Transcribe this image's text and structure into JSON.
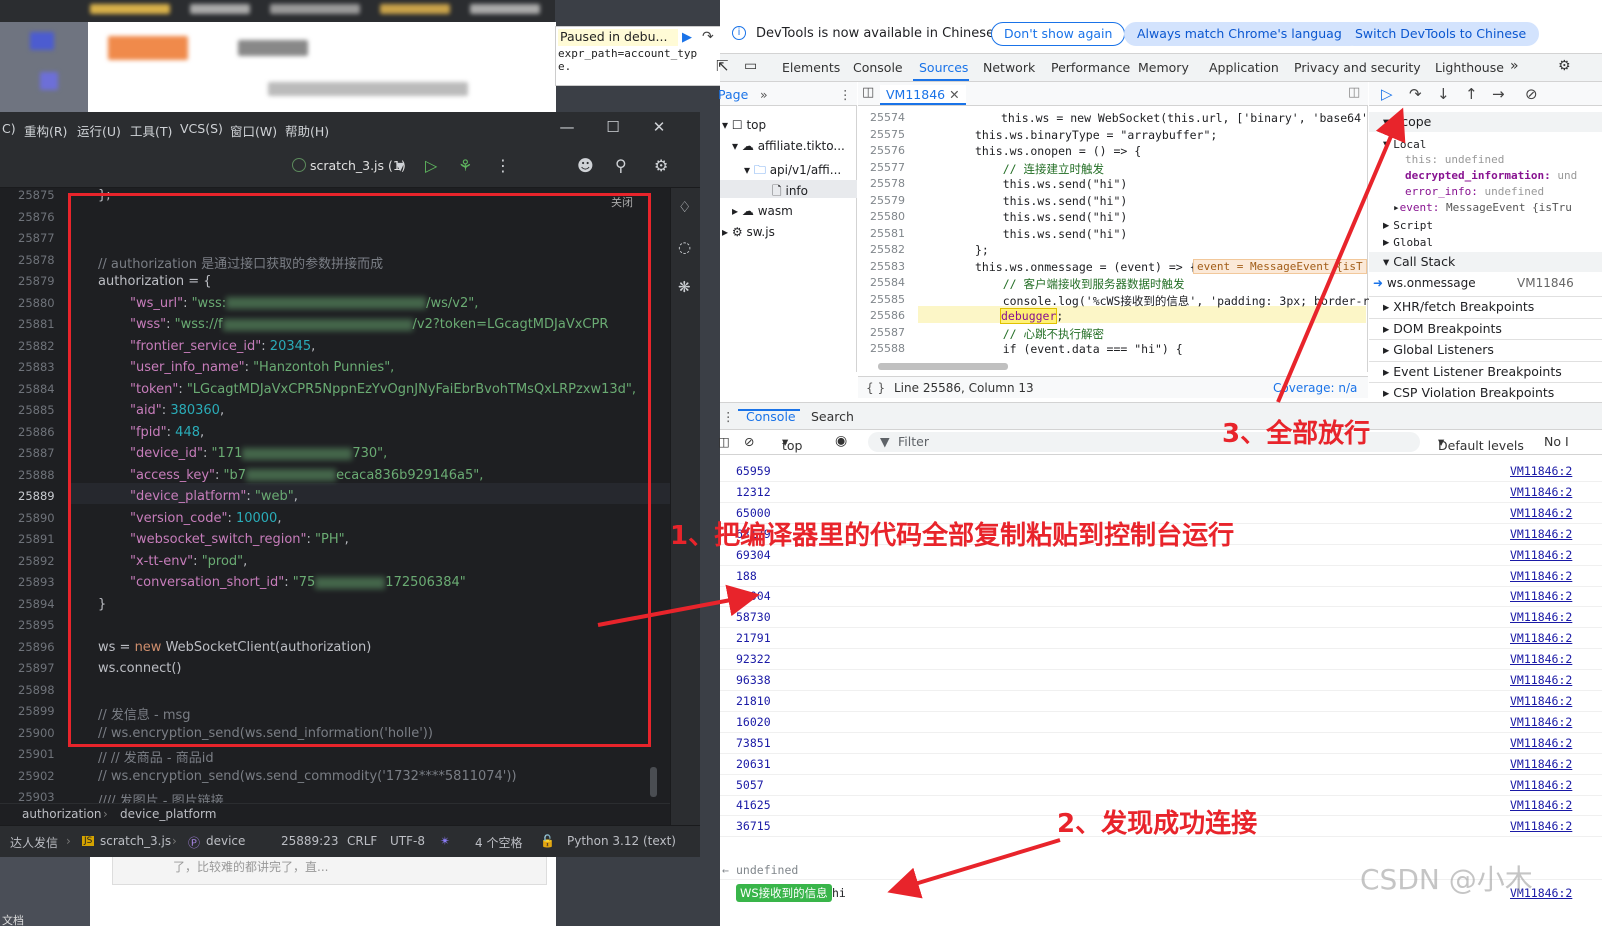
{
  "paused_bubble": {
    "title": "Paused in debu...",
    "code": "expr_path=account_typ\ne."
  },
  "ide": {
    "menu": [
      {
        "label": "C)",
        "name": "menu-code"
      },
      {
        "label": "重构(R)",
        "name": "menu-refactor"
      },
      {
        "label": "运行(U)",
        "name": "menu-run"
      },
      {
        "label": "工具(T)",
        "name": "menu-tools"
      },
      {
        "label": "VCS(S)",
        "name": "menu-vcs"
      },
      {
        "label": "窗口(W)",
        "name": "menu-window"
      },
      {
        "label": "帮助(H)",
        "name": "menu-help"
      }
    ],
    "run_config": "scratch_3.js (1)",
    "close_hint": "关闭",
    "line_numbers": [
      "25875",
      "25876",
      "25877",
      "25878",
      "25879",
      "25880",
      "25881",
      "25882",
      "25883",
      "25884",
      "25885",
      "25886",
      "25887",
      "25888",
      "25889",
      "25890",
      "25891",
      "25892",
      "25893",
      "25894",
      "25895",
      "25896",
      "25897",
      "25898",
      "25899",
      "25900",
      "25901",
      "25902",
      "25903"
    ],
    "active_line": "25889",
    "code": {
      "l0": "};",
      "comment_auth": "// authorization 是通过接口获取的参数拼接而成",
      "auth_open": "authorization = {",
      "ws_url_key": "\"ws_url\"",
      "ws_url_val": "\"wss:",
      "ws_url_tail": "/ws/v2\",",
      "wss_key": "\"wss\"",
      "wss_val": "\"wss://f",
      "wss_tail": "/v2?token=LGcagtMDJaVxCPR",
      "frontier_key": "\"frontier_service_id\"",
      "frontier_val": "20345",
      "user_info_key": "\"user_info_name\"",
      "user_info_val": "\"Hanzontoh Punnies\",",
      "token_key": "\"token\"",
      "token_val": "\"LGcagtMDJaVxCPR5NppnEzYvOgnJNyFaiEbrBvohTMsQxLRPzxw13d\",",
      "aid_key": "\"aid\"",
      "aid_val": "380360",
      "fpid_key": "\"fpid\"",
      "fpid_val": "448",
      "device_id_key": "\"device_id\"",
      "device_id_val": "\"171",
      "device_id_tail": "730\",",
      "access_key_key": "\"access_key\"",
      "access_key_val": "\"b7",
      "access_key_tail": "ecaca836b929146a5\",",
      "platform_key": "\"device_platform\"",
      "platform_val": "\"web\"",
      "version_key": "\"version_code\"",
      "version_val": "10000",
      "region_key": "\"websocket_switch_region\"",
      "region_val": "\"PH\"",
      "env_key": "\"x-tt-env\"",
      "env_val": "\"prod\"",
      "conv_key": "\"conversation_short_id\"",
      "conv_val": "\"75",
      "conv_tail": "172506384\"",
      "close_brace": "}",
      "ws_new_a": "ws = ",
      "ws_new_kw": "new",
      "ws_new_b": " WebSocketClient(authorization)",
      "ws_connect": "ws.connect()",
      "comment_msg": "// 发信息 - msg",
      "comment_send_info": "// ws.encryption_send(ws.send_information('holle'))",
      "comment_goods": "// // 发商品 - 商品id",
      "comment_send_goods": "// ws.encryption_send(ws.send_commodity('1732****5811074'))",
      "comment_img": "//// 发图片 - 图片链接"
    },
    "breadcrumbs": [
      "authorization",
      "device_platform"
    ],
    "status": {
      "project": "达人发信",
      "file": "scratch_3.js",
      "symbol": "device",
      "position": "25889:23",
      "line_sep": "CRLF",
      "encoding": "UTF-8",
      "indent": "4 个空格",
      "language": "Python 3.12 (text)"
    }
  },
  "bg": {
    "bottom_left_text": "文档",
    "bottom_page_text": "了，比较难的都讲完了，直..."
  },
  "devtools": {
    "infobar": {
      "text": "DevTools is now available in Chinese",
      "dont_show": "Don't show again",
      "match": "Always match Chrome's language",
      "switch": "Switch DevTools to Chinese"
    },
    "tabs": [
      "Elements",
      "Console",
      "Sources",
      "Network",
      "Performance",
      "Memory",
      "Application",
      "Privacy and security",
      "Lighthouse"
    ],
    "active_tab": "Sources",
    "nav": {
      "page_tab": "Page",
      "tree": [
        "top",
        "affiliate.tikto...",
        "api/v1/affi...",
        "info",
        "wasm",
        "sw.js"
      ]
    },
    "editor": {
      "file_tab": "VM11846",
      "line_numbers": [
        "25574",
        "25575",
        "25576",
        "25577",
        "25578",
        "25579",
        "25580",
        "25581",
        "25582",
        "25583",
        "25584",
        "25585",
        "25586",
        "25587",
        "25588"
      ],
      "lines": {
        "a1": "this.ws = new WebSocket(this.url, ['binary', 'base64',",
        "a2": "this.ws.binaryType = \"arraybuffer\";",
        "a3": "this.ws.onopen = () => {",
        "a4": "    // 连接建立时触发",
        "a5": "    this.ws.send(\"hi\")",
        "a6": "    this.ws.send(\"hi\")",
        "a7": "    this.ws.send(\"hi\")",
        "a8": "    this.ws.send(\"hi\")",
        "a9": "};",
        "a10": "this.ws.onmessage = (event) => {",
        "a11": "    // 客户端接收到服务器数据时触发",
        "a12": "    console.log('%cWS接收到的信息', 'padding: 3px; border-rad",
        "a13_kw": "debugger",
        "a14": "    // 心跳不执行解密",
        "a15": "    if (event.data === \"hi\") {"
      },
      "inline_value": "event = MessageEvent {isT",
      "footer_position": "Line 25586, Column 13",
      "footer_coverage": "Coverage: n/a"
    },
    "debugger": {
      "scope": "Scope",
      "local": "Local",
      "vars": [
        {
          "name": "this:",
          "value": "undefined"
        },
        {
          "name": "decrypted_information:",
          "value": "und"
        },
        {
          "name": "error_info:",
          "value": "undefined"
        },
        {
          "name": "event:",
          "value": "MessageEvent {isTru"
        }
      ],
      "script": "Script",
      "global": "Global",
      "call_stack": "Call Stack",
      "frame_name": "ws.onmessage",
      "frame_src": "VM11846",
      "sections": [
        "XHR/fetch Breakpoints",
        "DOM Breakpoints",
        "Global Listeners",
        "Event Listener Breakpoints",
        "CSP Violation Breakpoints"
      ]
    },
    "drawer_tabs": [
      "Console",
      "Search"
    ],
    "console_toolbar": {
      "context": "top",
      "filter": "Filter",
      "levels": "Default levels",
      "issues": "No I"
    },
    "console_rows": [
      {
        "v": "65959",
        "src": "VM11846:2"
      },
      {
        "v": "12312",
        "src": "VM11846:2"
      },
      {
        "v": "65000",
        "src": "VM11846:2"
      },
      {
        "v": "63179",
        "src": "VM11846:2"
      },
      {
        "v": "69304",
        "src": "VM11846:2"
      },
      {
        "v": "188",
        "src": "VM11846:2"
      },
      {
        "v": "22004",
        "src": "VM11846:2"
      },
      {
        "v": "58730",
        "src": "VM11846:2"
      },
      {
        "v": "21791",
        "src": "VM11846:2"
      },
      {
        "v": "92322",
        "src": "VM11846:2"
      },
      {
        "v": "96338",
        "src": "VM11846:2"
      },
      {
        "v": "21810",
        "src": "VM11846:2"
      },
      {
        "v": "16020",
        "src": "VM11846:2"
      },
      {
        "v": "73851",
        "src": "VM11846:2"
      },
      {
        "v": "20631",
        "src": "VM11846:2"
      },
      {
        "v": "5057",
        "src": "VM11846:2"
      },
      {
        "v": "41625",
        "src": "VM11846:2"
      },
      {
        "v": "36715",
        "src": "VM11846:2"
      }
    ],
    "undefined_text": "undefined",
    "ws_badge": "WS接收到的信息",
    "ws_msg": "hi",
    "ws_src": "VM11846:2"
  },
  "annotations": {
    "step1": "1、把编译器里的代码全部复制粘贴到控制台运行",
    "step2": "2、发现成功连接",
    "step3": "3、全部放行",
    "color": "#e8242b"
  },
  "watermark": "CSDN @小木"
}
